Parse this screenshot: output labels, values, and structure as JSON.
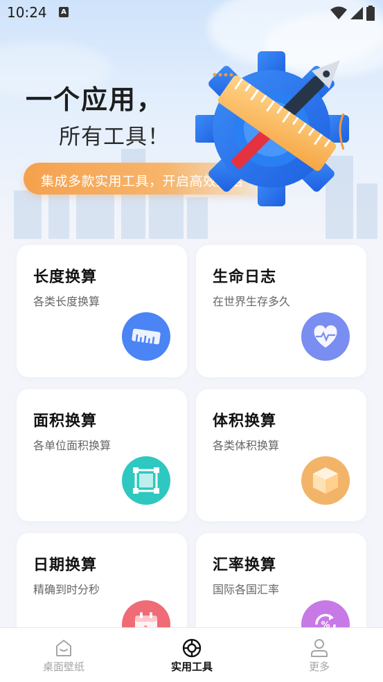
{
  "status_bar": {
    "time": "10:24",
    "notification_icon": "A"
  },
  "hero": {
    "title": "一个应用，",
    "subtitle": "所有工具！",
    "pill": "集成多款实用工具，开启高效生活"
  },
  "cards": [
    {
      "title": "长度换算",
      "desc": "各类长度换算",
      "icon": "ruler-icon",
      "color": "#4a84f5"
    },
    {
      "title": "生命日志",
      "desc": "在世界生存多久",
      "icon": "heart-icon",
      "color": "#7a8df0"
    },
    {
      "title": "面积换算",
      "desc": "各单位面积换算",
      "icon": "area-icon",
      "color": "#2ec8c0"
    },
    {
      "title": "体积换算",
      "desc": "各类体积换算",
      "icon": "box-icon",
      "color": "#f2b468"
    },
    {
      "title": "日期换算",
      "desc": "精确到时分秒",
      "icon": "calendar-icon",
      "color": "#ef6b76"
    },
    {
      "title": "汇率换算",
      "desc": "国际各国汇率",
      "icon": "exchange-icon",
      "color": "#c77ae6"
    }
  ],
  "tabs": [
    {
      "label": "桌面壁纸",
      "icon": "home-icon",
      "active": false
    },
    {
      "label": "实用工具",
      "icon": "tools-icon",
      "active": true
    },
    {
      "label": "更多",
      "icon": "user-icon",
      "active": false
    }
  ]
}
